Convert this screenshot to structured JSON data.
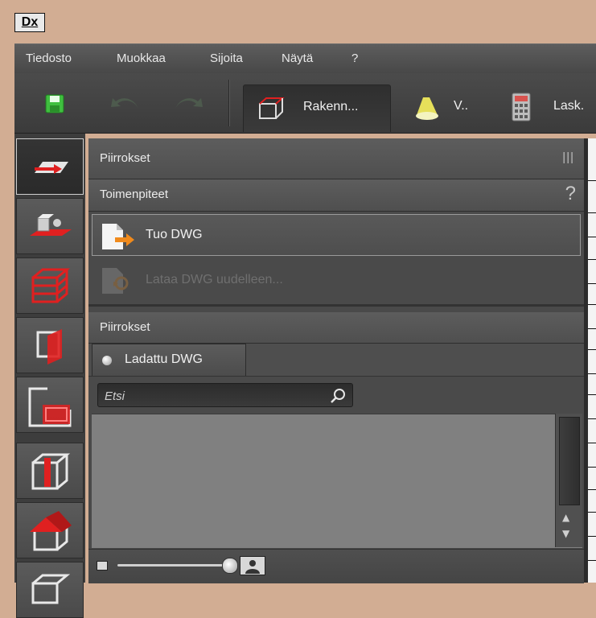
{
  "app": {
    "icon_text": "Dx"
  },
  "menu": [
    "Tiedosto",
    "Muokkaa",
    "Sijoita",
    "Näytä",
    "?"
  ],
  "toolbar": {
    "tabs": [
      {
        "label": "Rakenn...",
        "active": true
      },
      {
        "label": "V..",
        "active": false
      },
      {
        "label": "Lask.",
        "active": false
      }
    ]
  },
  "panel": {
    "header": "Piirrokset",
    "header_menu_glyph": "|||",
    "actions_header": "Toimenpiteet",
    "help_glyph": "?",
    "actions": [
      {
        "label": "Tuo DWG",
        "enabled": true
      },
      {
        "label": "Lataa DWG uudelleen...",
        "enabled": false
      }
    ],
    "drawings_header": "Piirrokset",
    "drawings_tab": "Ladattu DWG",
    "search_placeholder": "Etsi"
  },
  "colors": {
    "accent_red": "#e02020",
    "orange": "#f08a1c",
    "save_green": "#3fbf3f"
  }
}
